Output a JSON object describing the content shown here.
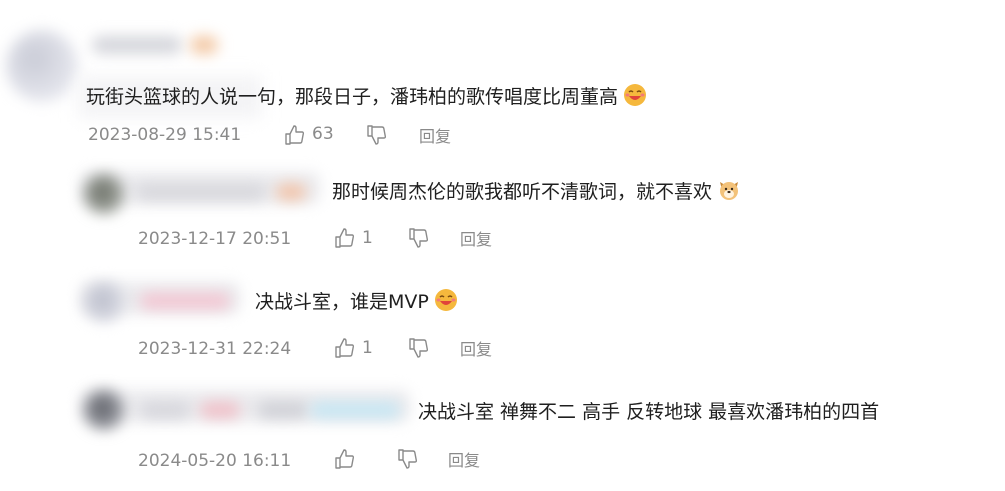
{
  "comments": [
    {
      "text": "玩街头篮球的人说一句，那段日子，潘玮柏的歌传唱度比周董高",
      "date": "2023-08-29 15:41",
      "likes": "63",
      "reply_label": "回复"
    }
  ],
  "replies": [
    {
      "text": "那时候周杰伦的歌我都听不清歌词，就不喜欢",
      "date": "2023-12-17 20:51",
      "likes": "1",
      "reply_label": "回复"
    },
    {
      "text": "决战斗室，谁是MVP",
      "date": "2023-12-31 22:24",
      "likes": "1",
      "reply_label": "回复"
    },
    {
      "text": "决战斗室 禅舞不二 高手 反转地球 最喜欢潘玮柏的四首",
      "date": "2024-05-20 16:11",
      "likes": "",
      "reply_label": "回复"
    }
  ],
  "colors": {
    "text": "#1f1f1f",
    "meta": "#8a8a8a",
    "emoji_face": "#f5b83d",
    "emoji_mouth": "#e0443a"
  }
}
